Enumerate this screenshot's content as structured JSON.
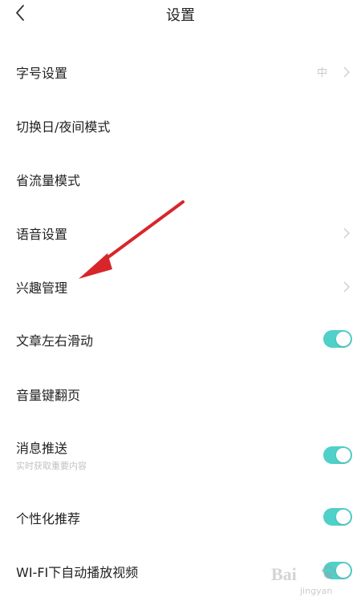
{
  "header": {
    "title": "设置"
  },
  "rows": [
    {
      "label": "字号设置",
      "value": "中"
    },
    {
      "label": "切换日/夜间模式"
    },
    {
      "label": "省流量模式"
    },
    {
      "label": "语音设置"
    },
    {
      "label": "兴趣管理"
    },
    {
      "label": "文章左右滑动",
      "toggle": "on"
    },
    {
      "label": "音量键翻页"
    },
    {
      "label": "消息推送",
      "sub": "实时获取重要内容",
      "toggle": "on"
    },
    {
      "label": "个性化推荐",
      "toggle": "on"
    },
    {
      "label": "WI-FI下自动播放视频",
      "toggle": "on"
    }
  ],
  "watermark": {
    "text": "Bai",
    "sub": "jingyan"
  },
  "colors": {
    "toggle_on": "#4fd0c9",
    "annotation_arrow": "#d7262a",
    "chevron": "#d0d0d0"
  }
}
